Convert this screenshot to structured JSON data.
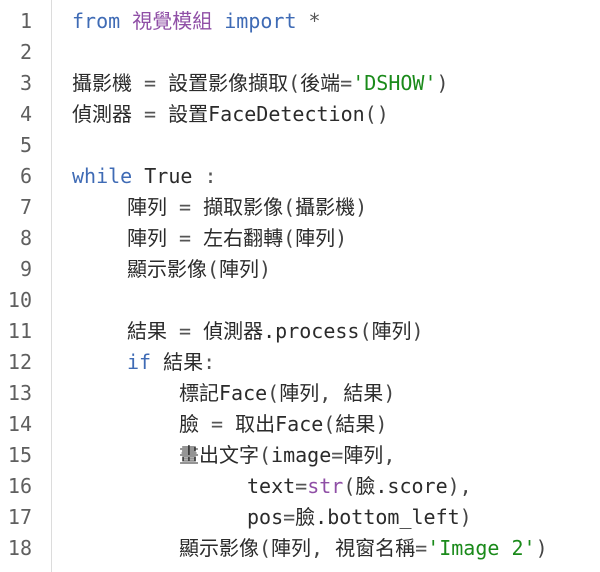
{
  "editor": {
    "language": "python",
    "colors": {
      "keyword": "#3f6bb5",
      "module": "#8f4fa6",
      "string": "#1a8a1a",
      "builtin": "#8f4fa6",
      "text": "#2b2b2b",
      "gutter_text": "#5f5f5f",
      "gutter_border": "#dcdcdc"
    },
    "lines": [
      {
        "num": "1",
        "indent": 0,
        "tokens": [
          {
            "t": "kw",
            "v": "from"
          },
          {
            "t": "op",
            "v": " "
          },
          {
            "t": "mod",
            "v": "視覺模組"
          },
          {
            "t": "op",
            "v": " "
          },
          {
            "t": "kw",
            "v": "import"
          },
          {
            "t": "op",
            "v": " *"
          }
        ]
      },
      {
        "num": "2",
        "indent": 0,
        "tokens": []
      },
      {
        "num": "3",
        "indent": 0,
        "tokens": [
          {
            "t": "id",
            "v": "攝影機"
          },
          {
            "t": "op",
            "v": " = "
          },
          {
            "t": "id",
            "v": "設置影像擷取"
          },
          {
            "t": "punc",
            "v": "("
          },
          {
            "t": "id",
            "v": "後端"
          },
          {
            "t": "op",
            "v": "="
          },
          {
            "t": "str",
            "v": "'DSHOW'"
          },
          {
            "t": "punc",
            "v": ")"
          }
        ]
      },
      {
        "num": "4",
        "indent": 0,
        "tokens": [
          {
            "t": "id",
            "v": "偵測器"
          },
          {
            "t": "op",
            "v": " = "
          },
          {
            "t": "id",
            "v": "設置FaceDetection"
          },
          {
            "t": "punc",
            "v": "()"
          }
        ]
      },
      {
        "num": "5",
        "indent": 0,
        "tokens": []
      },
      {
        "num": "6",
        "indent": 0,
        "tokens": [
          {
            "t": "kw",
            "v": "while"
          },
          {
            "t": "op",
            "v": " "
          },
          {
            "t": "id",
            "v": "True"
          },
          {
            "t": "op",
            "v": " :"
          }
        ]
      },
      {
        "num": "7",
        "indent": 1,
        "tokens": [
          {
            "t": "id",
            "v": "陣列"
          },
          {
            "t": "op",
            "v": " = "
          },
          {
            "t": "id",
            "v": "擷取影像"
          },
          {
            "t": "punc",
            "v": "("
          },
          {
            "t": "id",
            "v": "攝影機"
          },
          {
            "t": "punc",
            "v": ")"
          }
        ]
      },
      {
        "num": "8",
        "indent": 1,
        "tokens": [
          {
            "t": "id",
            "v": "陣列"
          },
          {
            "t": "op",
            "v": " = "
          },
          {
            "t": "id",
            "v": "左右翻轉"
          },
          {
            "t": "punc",
            "v": "("
          },
          {
            "t": "id",
            "v": "陣列"
          },
          {
            "t": "punc",
            "v": ")"
          }
        ]
      },
      {
        "num": "9",
        "indent": 1,
        "tokens": [
          {
            "t": "id",
            "v": "顯示影像"
          },
          {
            "t": "punc",
            "v": "("
          },
          {
            "t": "id",
            "v": "陣列"
          },
          {
            "t": "punc",
            "v": ")"
          }
        ]
      },
      {
        "num": "10",
        "indent": 0,
        "tokens": []
      },
      {
        "num": "11",
        "indent": 1,
        "tokens": [
          {
            "t": "id",
            "v": "結果"
          },
          {
            "t": "op",
            "v": " = "
          },
          {
            "t": "id",
            "v": "偵測器.process"
          },
          {
            "t": "punc",
            "v": "("
          },
          {
            "t": "id",
            "v": "陣列"
          },
          {
            "t": "punc",
            "v": ")"
          }
        ]
      },
      {
        "num": "12",
        "indent": 1,
        "tokens": [
          {
            "t": "kw",
            "v": "if"
          },
          {
            "t": "op",
            "v": " "
          },
          {
            "t": "id",
            "v": "結果"
          },
          {
            "t": "op",
            "v": ":"
          }
        ]
      },
      {
        "num": "13",
        "indent": 2,
        "tokens": [
          {
            "t": "id",
            "v": "標記Face"
          },
          {
            "t": "punc",
            "v": "("
          },
          {
            "t": "id",
            "v": "陣列"
          },
          {
            "t": "punc",
            "v": ", "
          },
          {
            "t": "id",
            "v": "結果"
          },
          {
            "t": "punc",
            "v": ")"
          }
        ]
      },
      {
        "num": "14",
        "indent": 2,
        "tokens": [
          {
            "t": "id",
            "v": "臉"
          },
          {
            "t": "op",
            "v": " = "
          },
          {
            "t": "id",
            "v": "取出Face"
          },
          {
            "t": "punc",
            "v": "("
          },
          {
            "t": "id",
            "v": "結果"
          },
          {
            "t": "punc",
            "v": ")"
          }
        ]
      },
      {
        "num": "15",
        "indent": 2,
        "tokens": [
          {
            "t": "id",
            "v": "畫出文字"
          },
          {
            "t": "punc",
            "v": "("
          },
          {
            "t": "id",
            "v": "image"
          },
          {
            "t": "op",
            "v": "="
          },
          {
            "t": "id",
            "v": "陣列"
          },
          {
            "t": "punc",
            "v": ","
          }
        ]
      },
      {
        "num": "16",
        "indent": 3,
        "tokens": [
          {
            "t": "id",
            "v": "text"
          },
          {
            "t": "op",
            "v": "="
          },
          {
            "t": "bi",
            "v": "str"
          },
          {
            "t": "punc",
            "v": "("
          },
          {
            "t": "id",
            "v": "臉.score"
          },
          {
            "t": "punc",
            "v": "),"
          }
        ]
      },
      {
        "num": "17",
        "indent": 3,
        "tokens": [
          {
            "t": "id",
            "v": "pos"
          },
          {
            "t": "op",
            "v": "="
          },
          {
            "t": "id",
            "v": "臉.bottom_left"
          },
          {
            "t": "punc",
            "v": ")"
          }
        ]
      },
      {
        "num": "18",
        "indent": 2,
        "tokens": [
          {
            "t": "id",
            "v": "顯示影像"
          },
          {
            "t": "punc",
            "v": "("
          },
          {
            "t": "id",
            "v": "陣列"
          },
          {
            "t": "punc",
            "v": ", "
          },
          {
            "t": "id",
            "v": "視窗名稱"
          },
          {
            "t": "op",
            "v": "="
          },
          {
            "t": "str",
            "v": "'Image 2'"
          },
          {
            "t": "punc",
            "v": ")"
          }
        ]
      }
    ]
  }
}
